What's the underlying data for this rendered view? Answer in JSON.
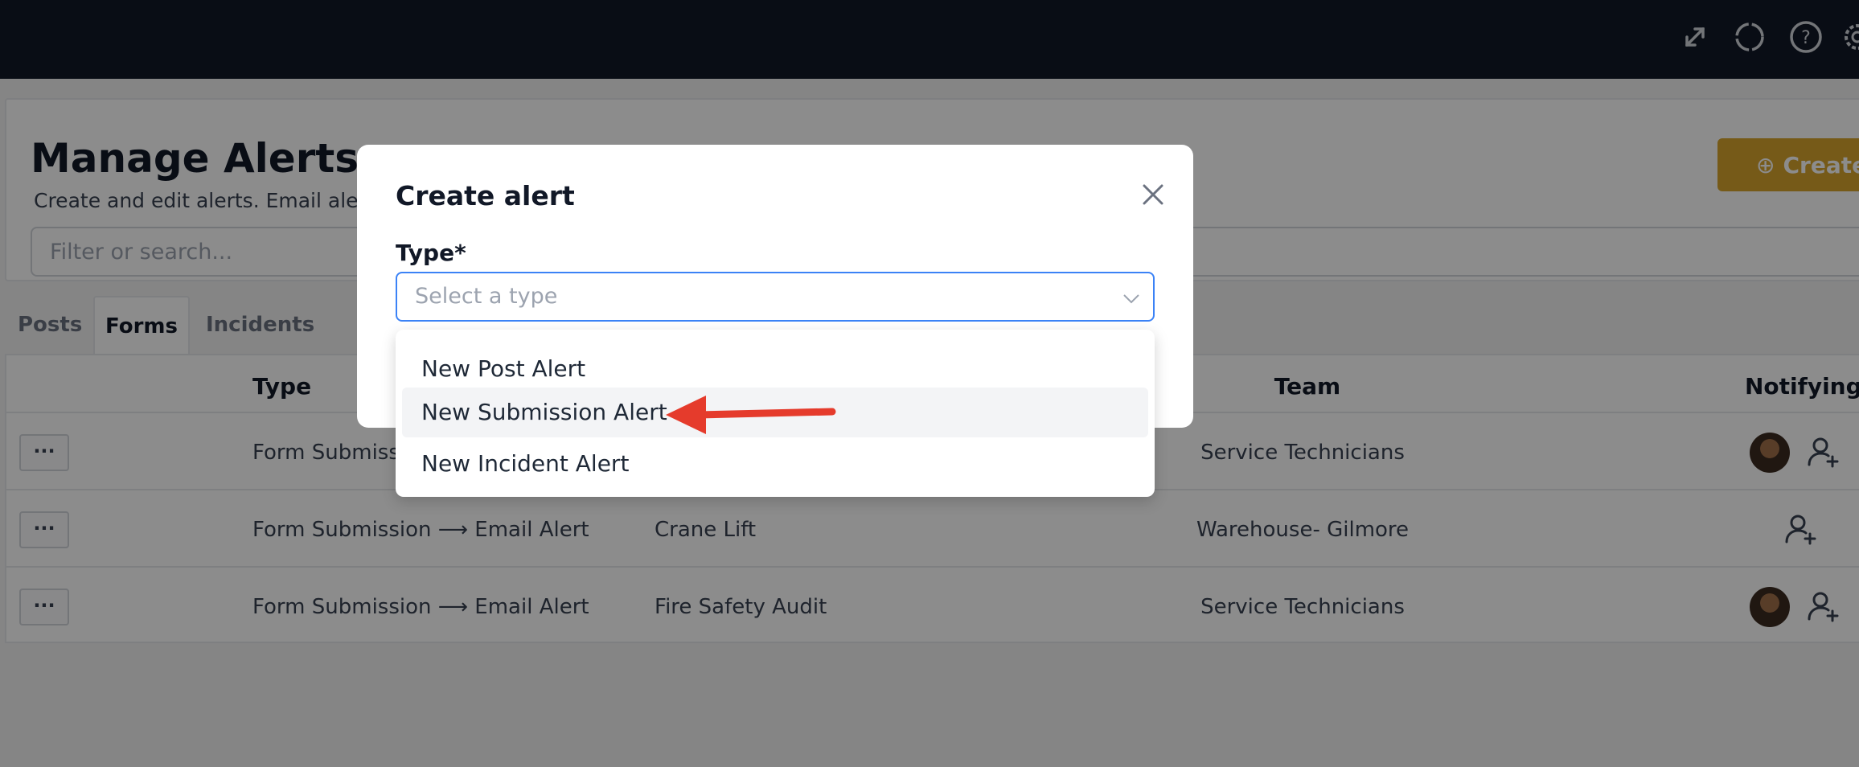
{
  "topbar": {
    "icons": [
      "expand-icon",
      "refresh-icon",
      "help-icon",
      "settings-icon"
    ]
  },
  "page": {
    "title": "Manage Alerts",
    "subtitle": "Create and edit alerts. Email alerts c",
    "create_button": "Create A",
    "search_placeholder": "Filter or search..."
  },
  "tabs": [
    {
      "label": "Posts"
    },
    {
      "label": "Forms"
    },
    {
      "label": "Incidents"
    }
  ],
  "table": {
    "headers": {
      "type": "Type",
      "team": "Team",
      "notifying": "Notifying"
    },
    "rows": [
      {
        "actions": "···",
        "type": "Form Submissio",
        "form": "",
        "team": "Service Technicians"
      },
      {
        "actions": "···",
        "type": "Form Submission ⟶ Email Alert",
        "form": "Crane Lift",
        "team": "Warehouse- Gilmore"
      },
      {
        "actions": "···",
        "type": "Form Submission ⟶ Email Alert",
        "form": "Fire Safety Audit",
        "team": "Service Technicians"
      }
    ]
  },
  "modal": {
    "title": "Create alert",
    "type_label": "Type*",
    "type_placeholder": "Select a type",
    "options": [
      {
        "label": "New Post Alert"
      },
      {
        "label": "New Submission Alert"
      },
      {
        "label": "New Incident Alert"
      }
    ],
    "highlighted_option": "New Submission Alert"
  },
  "colors": {
    "topbar": "#111827",
    "accent_button": "#d7a52d",
    "focus_border": "#3b82f6",
    "annotation_arrow": "#e53b2c"
  }
}
